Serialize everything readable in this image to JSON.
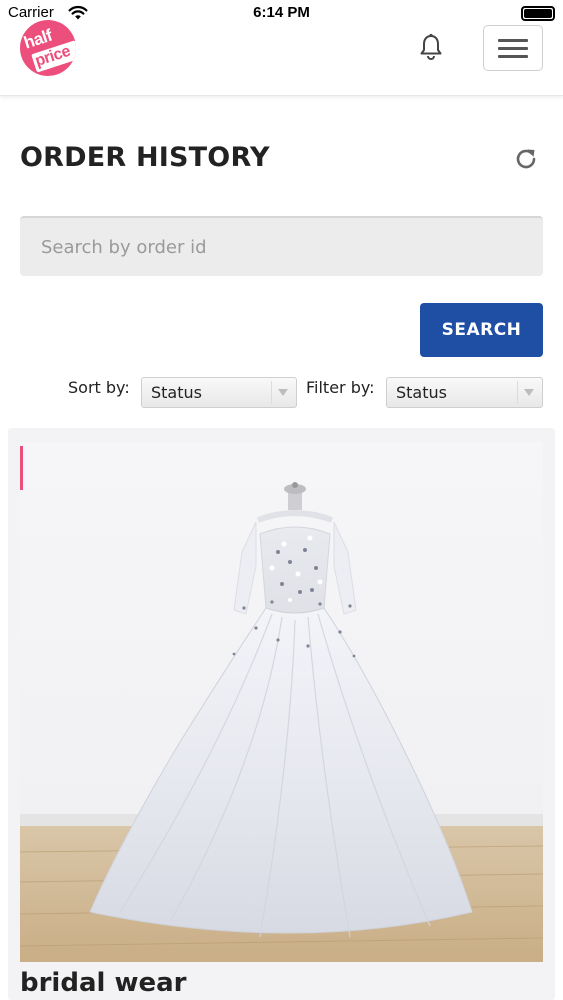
{
  "status_bar": {
    "carrier": "Carrier",
    "time": "6:14 PM"
  },
  "header": {
    "logo_text_top": "half",
    "logo_text_bottom": "price",
    "brand_color": "#ec4f7c",
    "icons": [
      "bell-icon",
      "hamburger-menu-icon"
    ]
  },
  "page": {
    "title": "ORDER HISTORY",
    "refresh_icon": "refresh-icon"
  },
  "search": {
    "placeholder": "Search by order id",
    "value": "",
    "button_label": "SEARCH",
    "button_color": "#1f4fa5"
  },
  "controls": {
    "sort_label": "Sort by:",
    "sort_value": "Status",
    "filter_label": "Filter by:",
    "filter_value": "Status"
  },
  "orders": [
    {
      "product_name": "bridal wear",
      "image": "white ball gown wedding dress on mannequin"
    }
  ]
}
